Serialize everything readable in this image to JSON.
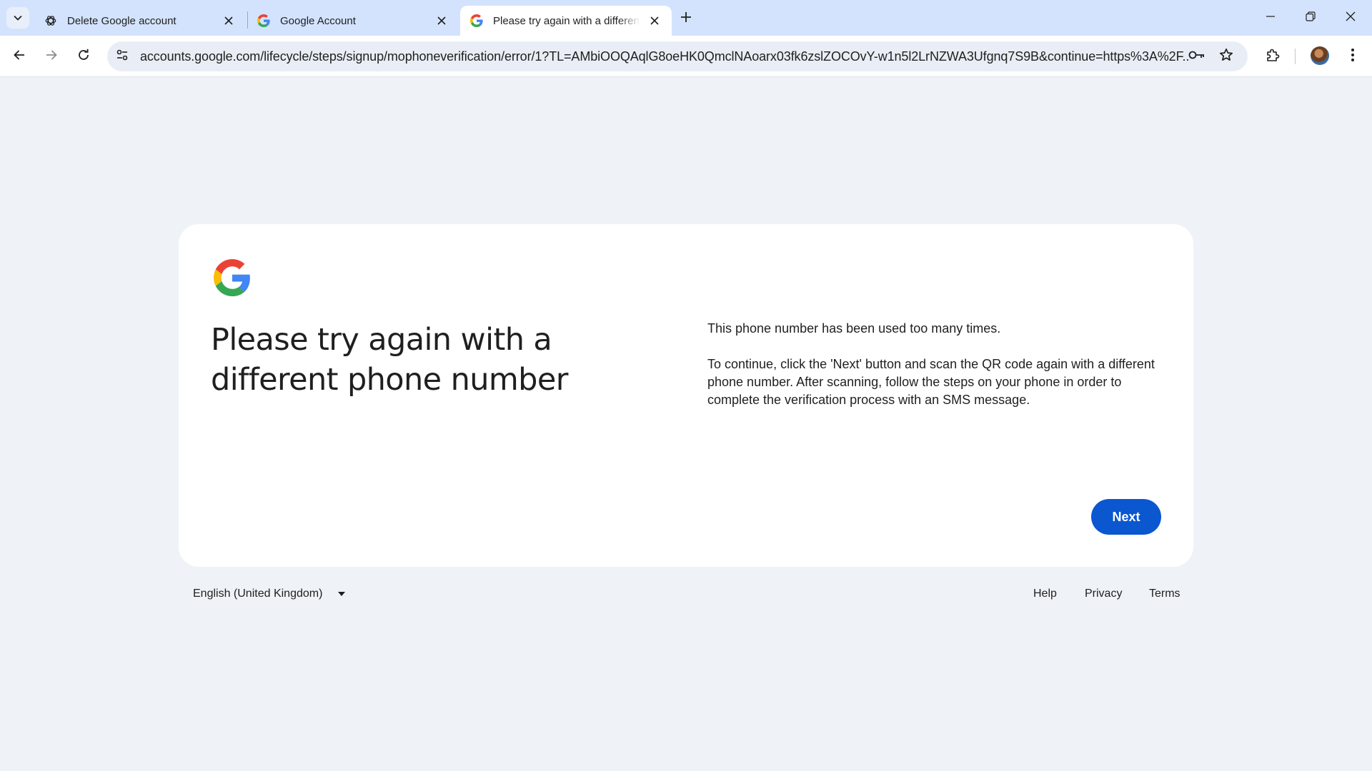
{
  "browser": {
    "tabs": [
      {
        "title": "Delete Google account",
        "icon": "chatgpt-icon",
        "active": false
      },
      {
        "title": "Google Account",
        "icon": "google-g-icon",
        "active": false
      },
      {
        "title": "Please try again with a different phone number",
        "icon": "google-g-icon",
        "active": true
      }
    ],
    "url": "accounts.google.com/lifecycle/steps/signup/mophoneverification/error/1?TL=AMbiOOQAqlG8oeHK0QmclNAoarx03fk6zslZOCOvY-w1n5l2LrNZWA3Ufgnq7S9B&continue=https%3A%2F..."
  },
  "page": {
    "heading": "Please try again with a different phone number",
    "paragraphs": [
      "This phone number has been used too many times.",
      "To continue, click the 'Next' button and scan the QR code again with a different phone number. After scanning, follow the steps on your phone in order to complete the verification process with an SMS message."
    ],
    "next_label": "Next"
  },
  "footer": {
    "language": "English (United Kingdom)",
    "links": [
      "Help",
      "Privacy",
      "Terms"
    ]
  },
  "colors": {
    "page_bg": "#eff2f6",
    "tabstrip_bg": "#d3e3fd",
    "primary_button": "#0b57d0"
  }
}
